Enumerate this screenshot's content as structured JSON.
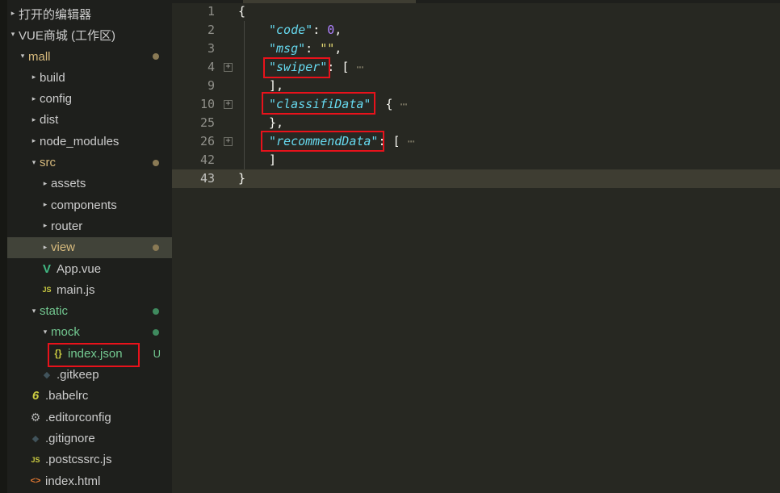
{
  "sidebar": {
    "open_editors": "打开的编辑器",
    "workspace": "VUE商城 (工作区)",
    "tree": [
      {
        "label": "mall",
        "twisty": "▾",
        "color": "#d7ba7d",
        "dot": "brown"
      },
      {
        "label": "build",
        "twisty": "▸",
        "color": "#cccccc"
      },
      {
        "label": "config",
        "twisty": "▸",
        "color": "#cccccc"
      },
      {
        "label": "dist",
        "twisty": "▸",
        "color": "#cccccc"
      },
      {
        "label": "node_modules",
        "twisty": "▸",
        "color": "#cccccc"
      },
      {
        "label": "src",
        "twisty": "▾",
        "color": "#d7ba7d",
        "dot": "brown"
      },
      {
        "label": "assets",
        "twisty": "▸",
        "color": "#cccccc"
      },
      {
        "label": "components",
        "twisty": "▸",
        "color": "#cccccc"
      },
      {
        "label": "router",
        "twisty": "▸",
        "color": "#cccccc"
      },
      {
        "label": "view",
        "twisty": "▸",
        "color": "#d7ba7d",
        "dot": "brown",
        "selected": true
      },
      {
        "label": "App.vue",
        "icon": "vue-icon",
        "color": "#cccccc"
      },
      {
        "label": "main.js",
        "icon": "js-icon",
        "color": "#cccccc"
      },
      {
        "label": "static",
        "twisty": "▾",
        "color": "#73c991",
        "dot": "green"
      },
      {
        "label": "mock",
        "twisty": "▾",
        "color": "#73c991",
        "dot": "green"
      },
      {
        "label": "index.json",
        "icon": "json-icon",
        "color": "#73c991",
        "badge": "U"
      },
      {
        "label": ".gitkeep",
        "icon": "git-icon",
        "color": "#cccccc"
      },
      {
        "label": ".babelrc",
        "icon": "babel-icon",
        "color": "#cccccc"
      },
      {
        "label": ".editorconfig",
        "icon": "gear-icon",
        "color": "#cccccc"
      },
      {
        "label": ".gitignore",
        "icon": "git-icon",
        "color": "#cccccc"
      },
      {
        "label": ".postcssrc.js",
        "icon": "js-icon",
        "color": "#cccccc"
      },
      {
        "label": "index.html",
        "icon": "html-icon",
        "color": "#cccccc"
      }
    ]
  },
  "editor": {
    "lines": [
      {
        "num": "1",
        "code": "{"
      },
      {
        "num": "2",
        "key": "\"code\"",
        "sep": ": ",
        "value": "0",
        "vtype": "n",
        "end": ","
      },
      {
        "num": "3",
        "key": "\"msg\"",
        "sep": ": ",
        "value": "\"\"",
        "vtype": "s",
        "end": ","
      },
      {
        "num": "4",
        "key": "\"swiper\"",
        "sep": ": ",
        "value": "[",
        "vtype": "p",
        "end": " ⋯",
        "fold": "+"
      },
      {
        "num": "9",
        "code": "],"
      },
      {
        "num": "10",
        "key": "\"classifiData\"",
        "sep": ": ",
        "value": "{",
        "vtype": "p",
        "end": " ⋯",
        "fold": "+"
      },
      {
        "num": "25",
        "code": "},"
      },
      {
        "num": "26",
        "key": "\"recommendData\"",
        "sep": ": ",
        "value": "[",
        "vtype": "p",
        "end": " ⋯",
        "fold": "+"
      },
      {
        "num": "42",
        "code": "]"
      },
      {
        "num": "43",
        "code": "}",
        "current": true
      }
    ]
  }
}
